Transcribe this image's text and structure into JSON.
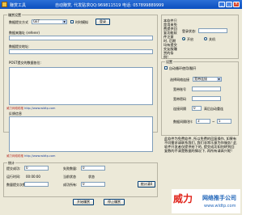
{
  "window": {
    "title": "赚赏工具",
    "info": "自动赚赏, 代发贴求QQ:969811519  电话: 057899889999",
    "min": "_",
    "max": "□",
    "close": "×"
  },
  "left": {
    "group_label": "赚赏设置",
    "post_method_label": "数据提交方式",
    "post_method_value": "GET",
    "post_method_arrow": "▼",
    "simulate_label": "时时模拟",
    "login_button": "登录",
    "referer_label": "数据来路址 (referer)",
    "submit_url_label": "数据提交地址:",
    "post_data_label": "POST提交的数据各位:",
    "link1_name": "威力网络助推",
    "link1_url": "http://www.wldtp.com",
    "result_label": "反馈信息",
    "link2_name": "威力网络助推",
    "link2_url": "http://www.wldtp.com",
    "stats_label": "统计",
    "success_label": "提交成功:",
    "success_value": "0",
    "fail_label": "失败数量:",
    "fail_value": "0",
    "runtime_label": "运行时间:",
    "runtime_value": "00:00:00",
    "current_count_label": "当前状态",
    "status_label": "状态",
    "submit_count_label": "数量提交次数:",
    "total_label": "成功所有:",
    "total_value": "0",
    "reset_button": "统计清0",
    "start_button": "开始赚赏",
    "stop_button": "停止赚赏"
  },
  "right": {
    "notice_top": "本软件只是用来免费提供回复功能软件注意时, 后期均有提交交友服赚赏的条例!",
    "login_status_label": "登录状态:",
    "radio_on_label": "开启",
    "radio_off_label": "关机",
    "settings_label": "设置",
    "loop_label": "自动循环使用/翻开",
    "select_label": "选择网络连接",
    "select_value": "宽带连接",
    "select_arrow": "▼",
    "account_label": "宽带账号",
    "password_label": "宽带密码",
    "interval_label": "连接间隔",
    "interval_value": "0",
    "interval_suffix": "高后自动重连",
    "data_interval_label": "数据间隔(秒):",
    "range_low": "3",
    "range_sep": "~",
    "range_high": "5",
    "notice_bottom": "此软件为免费软件, 所以免费的回复操作, 如果有不同需求请联系我们, 我们非常乐意为你服务! 此软件开发者仅提供给下的, 提交成功如何转到回复数的不清楚数据的情况下, 再所有请高兴呢!"
  },
  "logo": {
    "mark": "威力",
    "brand": "网络推手公司",
    "site": "www.wldtp.com"
  },
  "colors": {
    "titlebar": "#0b4fbf",
    "window_bg": "#ece9d8",
    "logo_red": "#e0231a",
    "logo_blue": "#1d63b8"
  }
}
